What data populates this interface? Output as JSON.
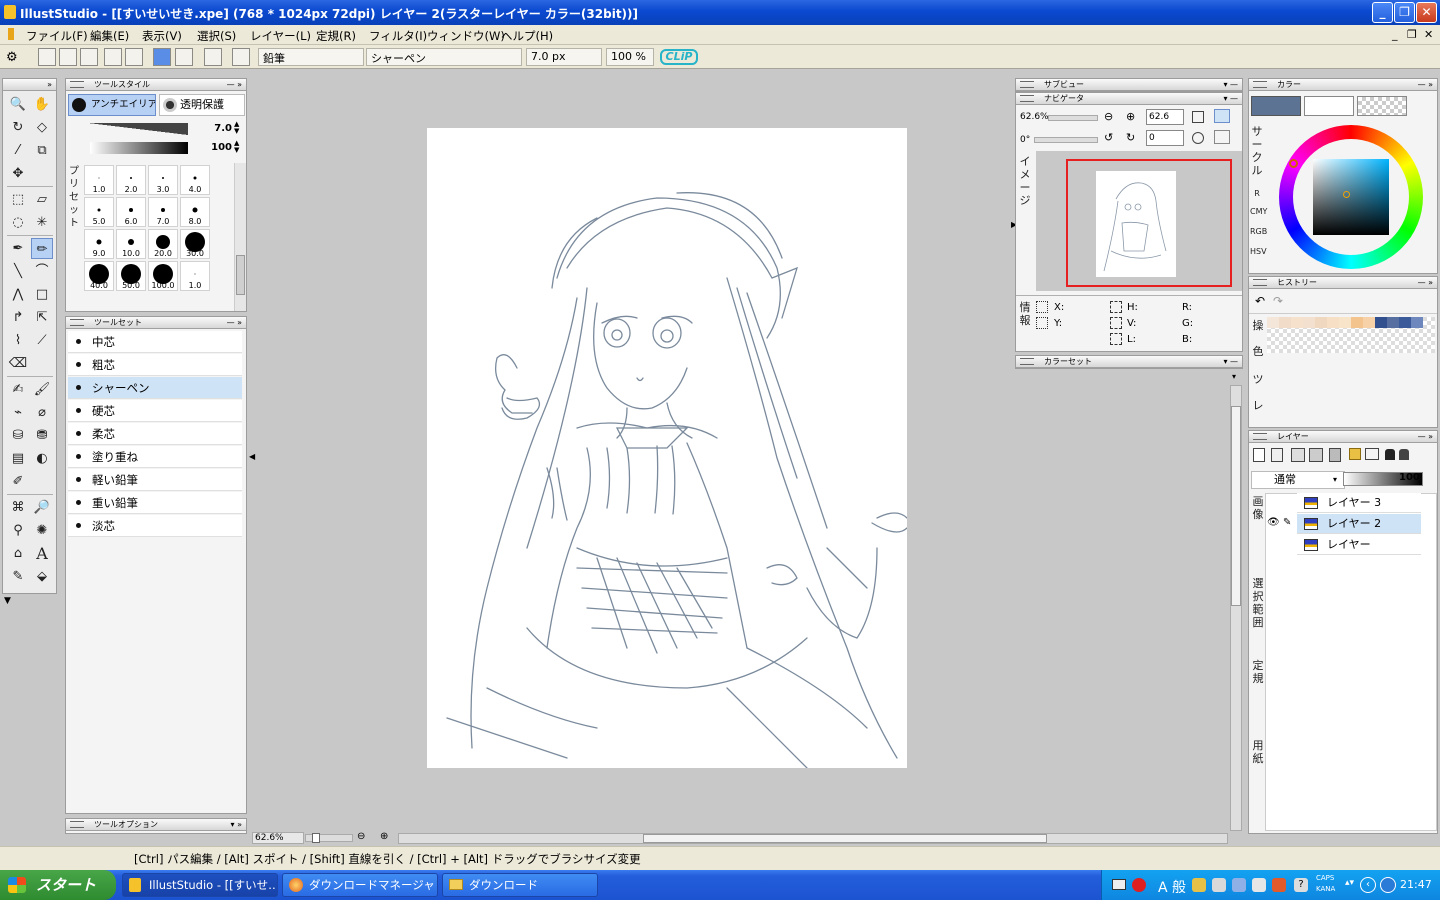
{
  "window": {
    "title": "IllustStudio - [[すいせいせき.xpe] (768 * 1024px 72dpi)     レイヤー 2(ラスターレイヤー カラー(32bit))]",
    "minimize": "_",
    "maximize": "❐",
    "close": "✕"
  },
  "menu": {
    "items": [
      "ファイル(F)",
      "編集(E)",
      "表示(V)",
      "選択(S)",
      "レイヤー(L)",
      "定規(R)",
      "フィルタ(I)",
      "ウィンドウ(W)",
      "ヘルプ(H)"
    ],
    "mdi_min": "_",
    "mdi_restore": "❐",
    "mdi_close": "✕"
  },
  "toolbar": {
    "tool_name": "鉛筆",
    "preset_name": "シャーペン",
    "brush_size": "7.0 px",
    "opacity": "100 %",
    "clip_logo": "CLiP"
  },
  "tool_style": {
    "title": "ツールスタイル",
    "antialias": "アンチエイリア…",
    "protect_alpha": "透明保護",
    "size_value": "7.0",
    "opacity_value": "100",
    "preset_label": "プリセット",
    "brushes": [
      {
        "label": "1.0",
        "d": 1
      },
      {
        "label": "2.0",
        "d": 2
      },
      {
        "label": "3.0",
        "d": 2
      },
      {
        "label": "4.0",
        "d": 3
      },
      {
        "label": "5.0",
        "d": 3
      },
      {
        "label": "6.0",
        "d": 4
      },
      {
        "label": "7.0",
        "d": 4
      },
      {
        "label": "8.0",
        "d": 5
      },
      {
        "label": "9.0",
        "d": 5
      },
      {
        "label": "10.0",
        "d": 6
      },
      {
        "label": "20.0",
        "d": 14
      },
      {
        "label": "30.0",
        "d": 20
      },
      {
        "label": "40.0",
        "d": 20
      },
      {
        "label": "50.0",
        "d": 20
      },
      {
        "label": "100.0",
        "d": 20
      },
      {
        "label": "1.0",
        "d": 1
      }
    ]
  },
  "tool_set": {
    "title": "ツールセット",
    "items": [
      "中芯",
      "粗芯",
      "シャーペン",
      "硬芯",
      "柔芯",
      "塗り重ね",
      "軽い鉛筆",
      "重い鉛筆",
      "淡芯"
    ],
    "selected_index": 2
  },
  "tool_option": {
    "title": "ツールオプション"
  },
  "canvas_status": {
    "zoom": "62.6%"
  },
  "subview": {
    "title": "サブビュー"
  },
  "navigator": {
    "title": "ナビゲータ",
    "zoom": "62.6%",
    "zoom_field": "62.6",
    "angle": "0°",
    "angle_field": "0",
    "image_label": "イメージ"
  },
  "info": {
    "label": "情報",
    "x": "X:",
    "y": "Y:",
    "h": "H:",
    "v": "V:",
    "l": "L:",
    "r": "R:",
    "g": "G:",
    "b": "B:"
  },
  "color_set": {
    "title": "カラーセット"
  },
  "color": {
    "title": "カラー",
    "circle_label": "サークル",
    "tabs": [
      "R",
      "CMY",
      "RGB",
      "HSV"
    ],
    "main_color": "#5d7394",
    "sub_color": "#ffffff"
  },
  "history": {
    "title": "ヒストリー",
    "tab_labels": [
      "操",
      "色",
      "ツ",
      "レ"
    ],
    "swatches": [
      "#f4e6d8",
      "#f0dcc8",
      "#f6e2cc",
      "#f3e0cf",
      "#f0d8c0",
      "#f6dfc5",
      "#f8e4c8",
      "#f3c48e",
      "#f7d1a8",
      "#33508e",
      "#566ea0",
      "#3b5a9a",
      "#6e87bc"
    ]
  },
  "layer": {
    "title": "レイヤー",
    "blend_mode": "通常",
    "opacity": "100",
    "side_labels": [
      "画像",
      "選択範囲",
      "定規",
      "用紙"
    ],
    "layers": [
      "レイヤー 3",
      "レイヤー 2",
      "レイヤー"
    ],
    "selected_index": 1
  },
  "status_bar": {
    "hint": "[Ctrl] パス編集 / [Alt] スポイト / [Shift] 直線を引く / [Ctrl] + [Alt] ドラッグでブラシサイズ変更"
  },
  "taskbar": {
    "start": "スタート",
    "tasks": [
      "IllustStudio - [[すいせ…",
      "ダウンロードマネージャ",
      "ダウンロード"
    ],
    "ime": "A 般",
    "caps": "CAPS",
    "kana": "KANA",
    "clock": "21:47"
  }
}
